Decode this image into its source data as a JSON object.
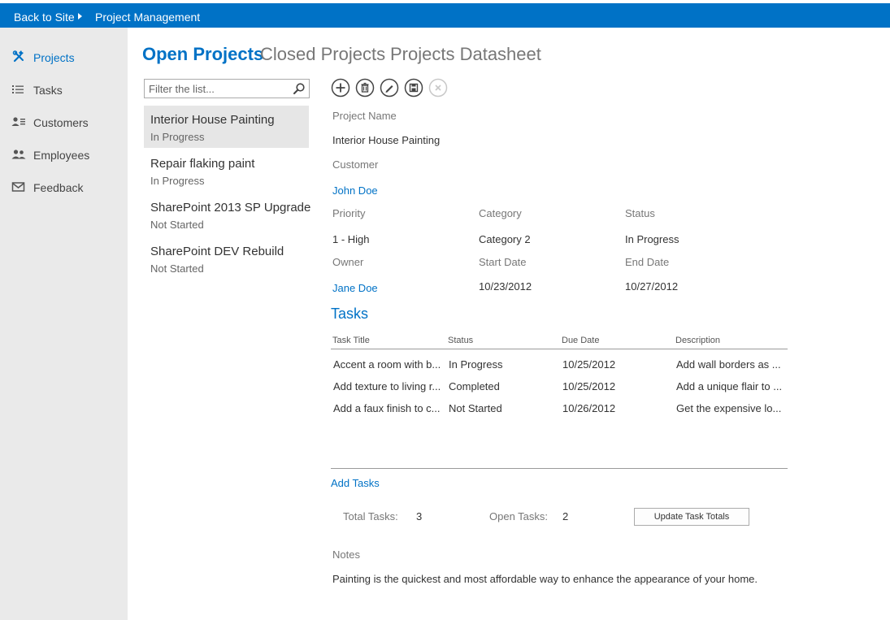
{
  "topbar": {
    "back": "Back to Site",
    "current": "Project Management"
  },
  "sidebar": {
    "items": [
      {
        "label": "Projects",
        "icon": "tools-icon"
      },
      {
        "label": "Tasks",
        "icon": "task-list-icon"
      },
      {
        "label": "Customers",
        "icon": "customers-icon"
      },
      {
        "label": "Employees",
        "icon": "employees-icon"
      },
      {
        "label": "Feedback",
        "icon": "envelope-icon"
      }
    ],
    "active": "Projects"
  },
  "tabs": [
    "Open Projects",
    "Closed Projects",
    "Projects Datasheet"
  ],
  "filter": {
    "placeholder": "Filter the list..."
  },
  "projects": [
    {
      "title": "Interior House Painting",
      "status": "In Progress"
    },
    {
      "title": "Repair flaking paint",
      "status": "In Progress"
    },
    {
      "title": "SharePoint 2013 SP Upgrade",
      "status": "Not Started"
    },
    {
      "title": "SharePoint DEV Rebuild",
      "status": "Not Started"
    }
  ],
  "toolbar": [
    "add-icon",
    "delete-icon",
    "edit-icon",
    "save-icon",
    "cancel-icon"
  ],
  "details": {
    "project_name_label": "Project Name",
    "project_name": "Interior House Painting",
    "customer_label": "Customer",
    "customer": "John Doe",
    "priority_label": "Priority",
    "priority": "1 - High",
    "category_label": "Category",
    "category": "Category 2",
    "status_label": "Status",
    "status": "In Progress",
    "owner_label": "Owner",
    "owner": "Jane Doe",
    "start_label": "Start Date",
    "start": "10/23/2012",
    "end_label": "End Date",
    "end": "10/27/2012"
  },
  "tasks": {
    "title": "Tasks",
    "columns": [
      "Task Title",
      "Status",
      "Due Date",
      "Description"
    ],
    "rows": [
      [
        "Accent a room with b...",
        "In Progress",
        "10/25/2012",
        "Add wall borders as ..."
      ],
      [
        "Add texture to living r...",
        "Completed",
        "10/25/2012",
        "Add a unique flair to ..."
      ],
      [
        "Add a faux finish to c...",
        "Not Started",
        "10/26/2012",
        "Get the expensive lo..."
      ]
    ],
    "add_label": "Add Tasks",
    "total_label": "Total Tasks:",
    "total": "3",
    "open_label": "Open Tasks:",
    "open": "2",
    "update_button": "Update Task Totals"
  },
  "notes": {
    "label": "Notes",
    "text": "Painting is the quickest and most affordable way to enhance the appearance of your home."
  },
  "colors": {
    "accent": "#0072c6",
    "sidebar": "#eaeaea",
    "selected": "#e6e6e6"
  }
}
